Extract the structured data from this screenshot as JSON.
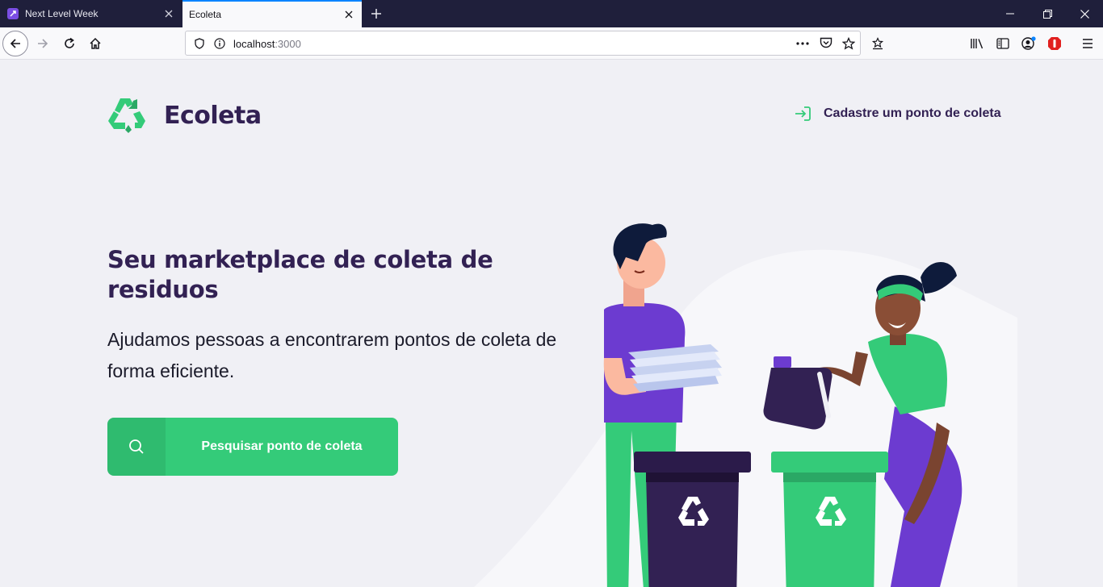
{
  "browser": {
    "tabs": [
      {
        "title": "Next Level Week",
        "active": false
      },
      {
        "title": "Ecoleta",
        "active": true
      }
    ],
    "url": {
      "host": "localhost",
      "port": ":3000"
    }
  },
  "header": {
    "brand": "Ecoleta",
    "cta": "Cadastre um ponto de coleta"
  },
  "hero": {
    "title": "Seu marketplace de coleta de residuos",
    "description": "Ajudamos pessoas a encontrarem pontos de coleta de forma eficiente.",
    "button_label": "Pesquisar ponto de coleta"
  },
  "colors": {
    "primary": "#34CB79",
    "title": "#322153",
    "background": "#F0F0F5",
    "accent_purple": "#6C3BD0"
  }
}
